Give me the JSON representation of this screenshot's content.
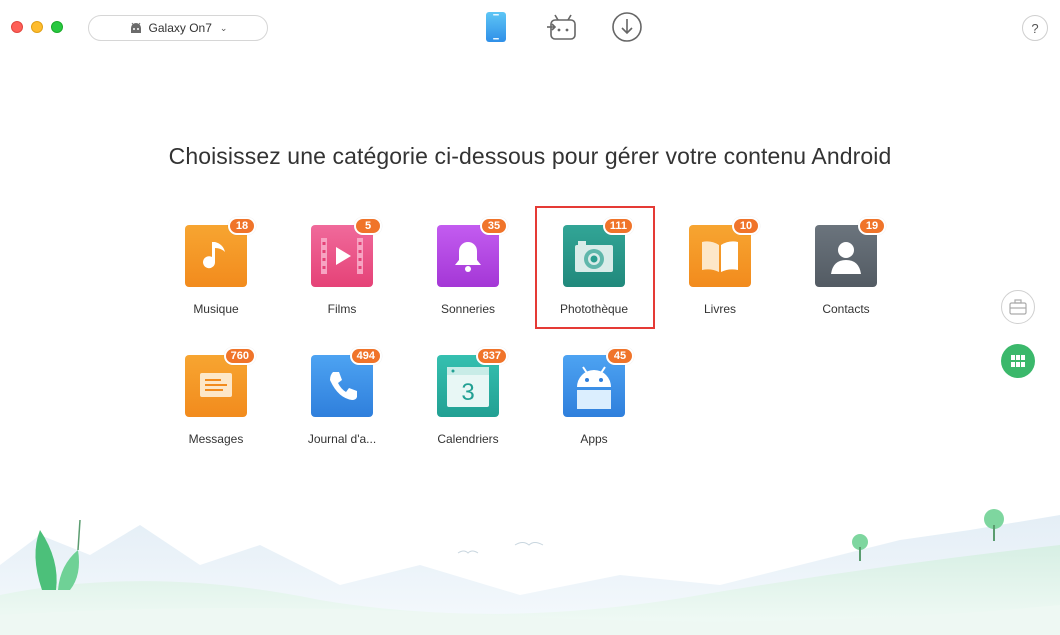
{
  "window": {
    "device_selector": {
      "label": "Galaxy On7",
      "icon": "android-icon"
    },
    "top_tabs": [
      {
        "name": "device-manager",
        "icon": "phone-icon",
        "active": true
      },
      {
        "name": "android-mover",
        "icon": "android-transfer-icon",
        "active": false
      },
      {
        "name": "downloader",
        "icon": "download-icon",
        "active": false
      }
    ],
    "help_label": "?"
  },
  "main": {
    "headline": "Choisissez une catégorie ci-dessous pour gérer votre contenu Android",
    "categories": [
      {
        "label": "Musique",
        "count": "18",
        "color": "#f59a28",
        "icon": "music-note-icon"
      },
      {
        "label": "Films",
        "count": "5",
        "color": "#ec4f87",
        "icon": "film-icon"
      },
      {
        "label": "Sonneries",
        "count": "35",
        "color": "#b548e0",
        "icon": "bell-icon"
      },
      {
        "label": "Photothèque",
        "count": "111",
        "color": "#2a9e8f",
        "icon": "camera-icon",
        "selected": true
      },
      {
        "label": "Livres",
        "count": "10",
        "color": "#f59a28",
        "icon": "book-icon"
      },
      {
        "label": "Contacts",
        "count": "19",
        "color": "#5e6770",
        "icon": "contact-icon"
      },
      {
        "label": "Messages",
        "count": "760",
        "color": "#f59a28",
        "icon": "message-icon"
      },
      {
        "label": "Journal d'a...",
        "count": "494",
        "color": "#3d8fe6",
        "icon": "phone-call-icon"
      },
      {
        "label": "Calendriers",
        "count": "837",
        "color": "#2cb3a4",
        "icon": "calendar-icon",
        "calendar_day": "3"
      },
      {
        "label": "Apps",
        "count": "45",
        "color": "#3d8fe6",
        "icon": "android-apps-icon"
      }
    ]
  },
  "side": {
    "toolbox_icon": "toolbox-icon",
    "grid_icon": "grid-icon"
  },
  "colors": {
    "badge": "#f0742a",
    "selection_frame": "#e53a35",
    "accent_green": "#3bb86b"
  }
}
